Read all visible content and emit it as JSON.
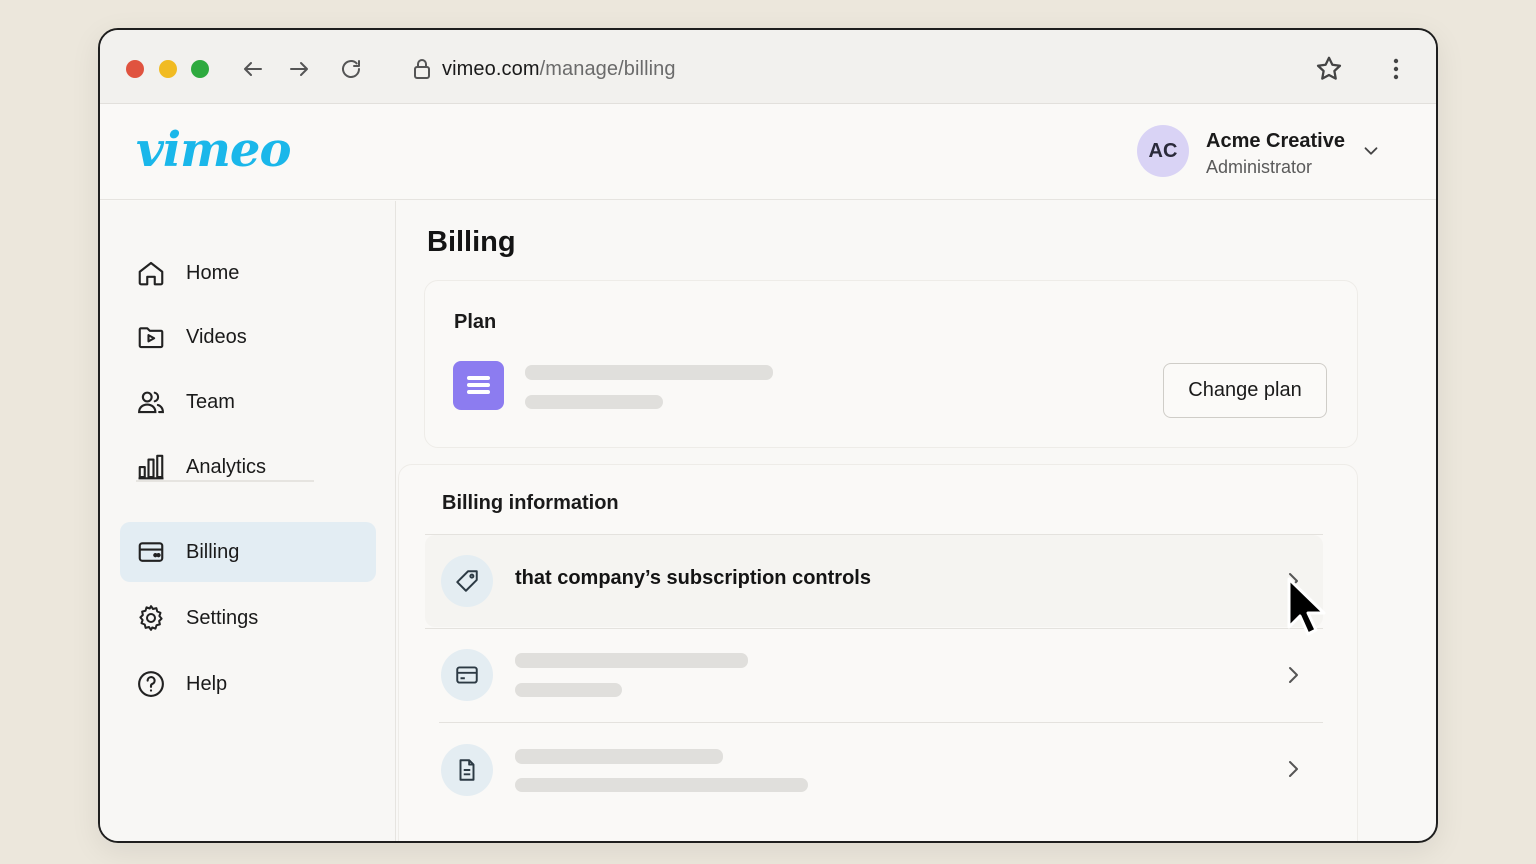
{
  "browser": {
    "url_domain": "vimeo.com",
    "url_path": "/manage/billing"
  },
  "header": {
    "logo": "vimeo",
    "account": {
      "initials": "AC",
      "name": "Acme Creative",
      "role": "Administrator"
    }
  },
  "sidebar": {
    "items": [
      {
        "label": "Home",
        "icon": "home-icon"
      },
      {
        "label": "Videos",
        "icon": "video-folder-icon"
      },
      {
        "label": "Team",
        "icon": "team-icon"
      },
      {
        "label": "Analytics",
        "icon": "bar-chart-icon"
      },
      {
        "label": "Billing",
        "icon": "billing-card-icon",
        "active": true
      },
      {
        "label": "Settings",
        "icon": "gear-icon"
      },
      {
        "label": "Help",
        "icon": "help-icon"
      }
    ]
  },
  "main": {
    "title": "Billing",
    "plan": {
      "heading": "Plan",
      "change_button": "Change plan"
    },
    "billing_info": {
      "heading": "Billing information",
      "rows": [
        {
          "label": "that company’s subscription controls",
          "icon": "tag-icon"
        },
        {
          "label": "",
          "icon": "credit-card-icon"
        },
        {
          "label": "",
          "icon": "document-icon"
        }
      ]
    }
  },
  "colors": {
    "brand": "#1ab7ea",
    "plan_icon": "#8c7cf0",
    "active_nav": "#e3edf3",
    "avatar": "#d9d3f5"
  }
}
